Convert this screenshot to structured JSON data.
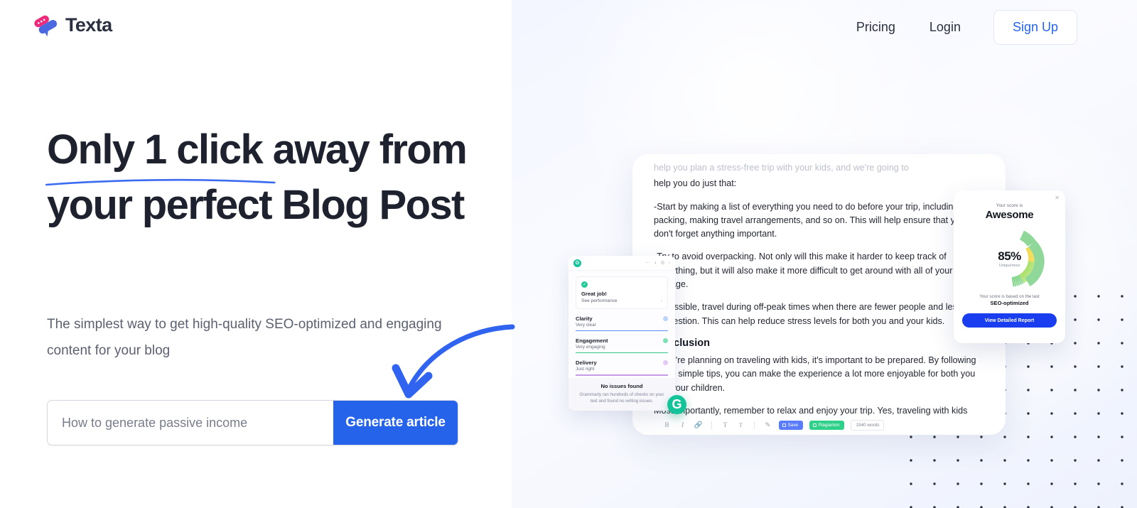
{
  "brand": {
    "name": "Texta",
    "logo_icon": "chat-bubble-logo",
    "pink": "#ee2a7b",
    "blue": "#4a68e0"
  },
  "nav": {
    "links": [
      {
        "label": "Pricing",
        "name": "pricing"
      },
      {
        "label": "Login",
        "name": "login"
      }
    ],
    "signup_label": "Sign Up"
  },
  "hero": {
    "headline_underlined": "Only 1 click",
    "headline_rest": " away from your perfect Blog Post",
    "subtitle": "The simplest way to get high-quality SEO-optimized and engaging content for your blog",
    "input_placeholder": "How to generate passive income",
    "input_value": "",
    "cta_label": "Generate article",
    "accent_color": "#2563eb"
  },
  "document": {
    "faded_line": "help you plan a stress-free trip with your kids, and we're going to",
    "paragraphs": [
      "help you do just that:",
      "-Start by making a list of everything you need to do before your trip, including packing, making travel arrangements, and so on. This will help ensure that you don't forget anything important.",
      "-Try to avoid overpacking. Not only will this make it harder to keep track of everything, but it will also make it more difficult to get around with all of your luggage.",
      "-If possible, travel during off-peak times when there are fewer people and less congestion. This can help reduce stress levels for both you and your kids."
    ],
    "heading": "Conclusion",
    "conclusion_paragraphs": [
      "If you're planning on traveling with kids, it's important to be prepared. By following some simple tips, you can make the experience a lot more enjoyable for both you and your children.",
      "Most importantly, remember to relax and enjoy your trip. Yes, traveling with kids can be challenging at times but it's also an"
    ],
    "toolbar": {
      "icons": [
        {
          "glyph": "B",
          "name": "bold-icon"
        },
        {
          "glyph": "I",
          "name": "italic-icon"
        },
        {
          "glyph": "⚓",
          "name": "link-icon"
        },
        {
          "glyph": "T",
          "name": "text-large-icon"
        },
        {
          "glyph": "T",
          "name": "text-small-icon"
        },
        {
          "glyph": "✂",
          "name": "clear-format-icon"
        }
      ],
      "save_label": "Save",
      "plagiarism_label": "Plagiarism",
      "word_count": "1540 words"
    }
  },
  "grammarly": {
    "logo_letter": "G",
    "great_job_title": "Great job!",
    "great_job_sub": "See performance",
    "metrics": [
      {
        "name": "Clarity",
        "value": "Very clear",
        "color": "#5b8def"
      },
      {
        "name": "Engagement",
        "value": "Very engaging",
        "color": "#34c98b"
      },
      {
        "name": "Delivery",
        "value": "Just right",
        "color": "#c79be8"
      }
    ],
    "footer_title": "No issues found",
    "footer_sub": "Grammarly ran hundreds of checks on your text and found no writing issues."
  },
  "score_card": {
    "close_icon": "close-icon",
    "label": "Your score is",
    "title": "Awesome",
    "percent": "85%",
    "caption": "Uniqueness",
    "note_line1": "Your score is based on the last",
    "note_line2": "SEO-optimized",
    "button_label": "View Detailed Report",
    "gauge_value": 85,
    "gauge_colors": {
      "start": "#f3d94e",
      "mid": "#a9e06a",
      "end": "#86d68f"
    }
  }
}
